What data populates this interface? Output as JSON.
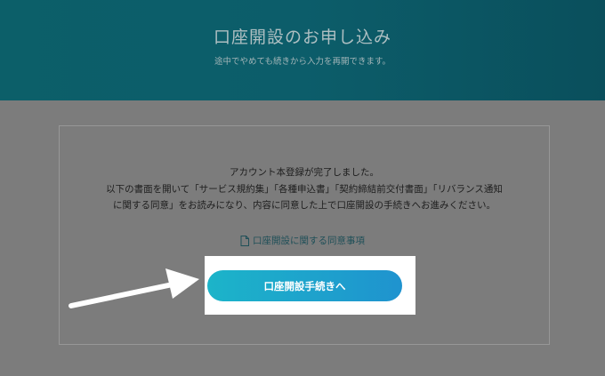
{
  "header": {
    "title": "口座開設のお申し込み",
    "subtitle": "途中でやめても続きから入力を再開できます。"
  },
  "message": {
    "lines": [
      "アカウント本登録が完了しました。",
      "以下の書面を開いて「サービス規約集」「各種申込書」「契約締結前交付書面」「リバランス通知",
      "に関する同意」をお読みになり、内容に同意した上で口座開設の手続きへお進みください。"
    ]
  },
  "links": {
    "consent_doc": {
      "label": "口座開設に関する同意事項",
      "icon": "document-icon"
    }
  },
  "actions": {
    "proceed_label": "口座開設手続きへ"
  },
  "colors": {
    "header_bg": "#0c5d6a",
    "overlay_bg": "#7c7c7c",
    "button_start": "#1cb4c9",
    "button_end": "#1f93cf",
    "link": "#1f4f58"
  }
}
